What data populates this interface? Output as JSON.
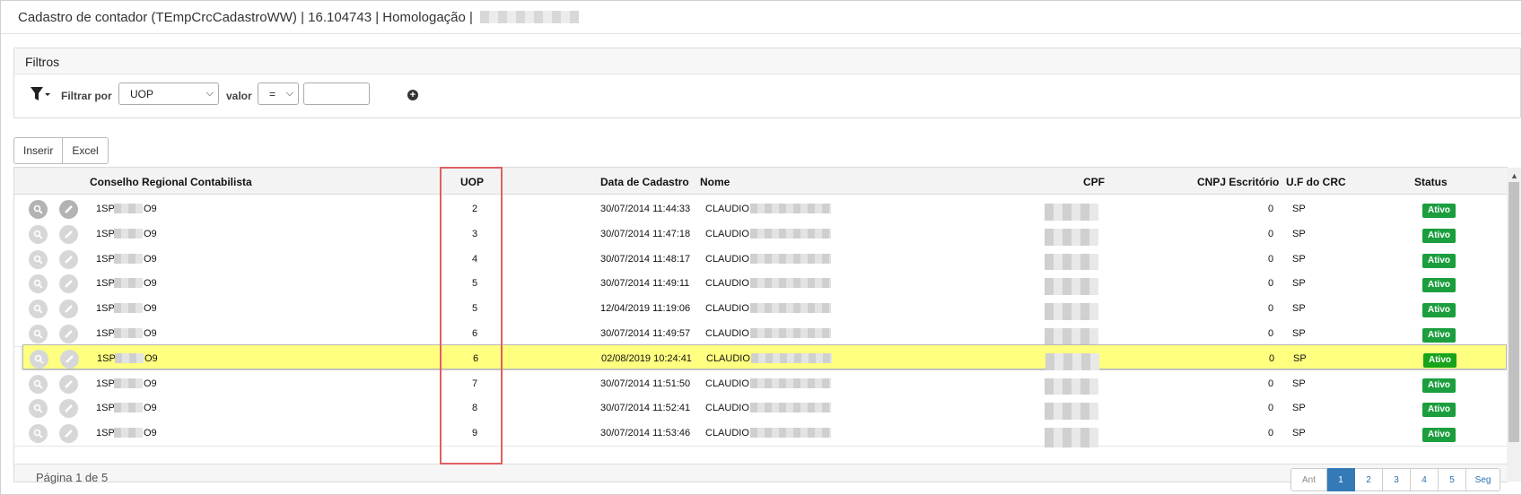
{
  "title": {
    "text": "Cadastro de contador (TEmpCrcCadastroWW) | 16.104743 | Homologação |"
  },
  "filters": {
    "heading": "Filtros",
    "filter_by_label": "Filtrar por",
    "field_select_value": "UOP",
    "value_label": "valor",
    "operator_value": "=",
    "value_input": ""
  },
  "actions": {
    "insert_label": "Inserir",
    "excel_label": "Excel"
  },
  "table": {
    "columns": [
      "Conselho Regional Contabilista",
      "UOP",
      "Data de Cadastro",
      "Nome",
      "CPF",
      "CNPJ Escritório",
      "U.F do CRC",
      "Status"
    ],
    "rows": [
      {
        "crc_prefix": "1SP",
        "crc_suffix": "O9",
        "uop": "2",
        "data": "30/07/2014 11:44:33",
        "nome": "CLAUDIO",
        "cnpj": "0",
        "uf": "SP",
        "status": "Ativo"
      },
      {
        "crc_prefix": "1SP",
        "crc_suffix": "O9",
        "uop": "3",
        "data": "30/07/2014 11:47:18",
        "nome": "CLAUDIO",
        "cnpj": "0",
        "uf": "SP",
        "status": "Ativo"
      },
      {
        "crc_prefix": "1SP",
        "crc_suffix": "O9",
        "uop": "4",
        "data": "30/07/2014 11:48:17",
        "nome": "CLAUDIO",
        "cnpj": "0",
        "uf": "SP",
        "status": "Ativo"
      },
      {
        "crc_prefix": "1SP",
        "crc_suffix": "O9",
        "uop": "5",
        "data": "30/07/2014 11:49:11",
        "nome": "CLAUDIO",
        "cnpj": "0",
        "uf": "SP",
        "status": "Ativo"
      },
      {
        "crc_prefix": "1SP",
        "crc_suffix": "O9",
        "uop": "5",
        "data": "12/04/2019 11:19:06",
        "nome": "CLAUDIO",
        "cnpj": "0",
        "uf": "SP",
        "status": "Ativo"
      },
      {
        "crc_prefix": "1SP",
        "crc_suffix": "O9",
        "uop": "6",
        "data": "30/07/2014 11:49:57",
        "nome": "CLAUDIO",
        "cnpj": "0",
        "uf": "SP",
        "status": "Ativo"
      },
      {
        "crc_prefix": "1SP",
        "crc_suffix": "O9",
        "uop": "6",
        "data": "02/08/2019 10:24:41",
        "nome": "CLAUDIO",
        "cnpj": "0",
        "uf": "SP",
        "status": "Ativo"
      },
      {
        "crc_prefix": "1SP",
        "crc_suffix": "O9",
        "uop": "7",
        "data": "30/07/2014 11:51:50",
        "nome": "CLAUDIO",
        "cnpj": "0",
        "uf": "SP",
        "status": "Ativo"
      },
      {
        "crc_prefix": "1SP",
        "crc_suffix": "O9",
        "uop": "8",
        "data": "30/07/2014 11:52:41",
        "nome": "CLAUDIO",
        "cnpj": "0",
        "uf": "SP",
        "status": "Ativo"
      },
      {
        "crc_prefix": "1SP",
        "crc_suffix": "O9",
        "uop": "9",
        "data": "30/07/2014 11:53:46",
        "nome": "CLAUDIO",
        "cnpj": "0",
        "uf": "SP",
        "status": "Ativo"
      }
    ],
    "highlighted_row": 6
  },
  "pagination": {
    "info": "Página 1 de 5",
    "prev_label": "Ant",
    "pages": [
      "1",
      "2",
      "3",
      "4",
      "5"
    ],
    "current_page": "1",
    "next_label": "Seg"
  },
  "icons": {
    "filter": "funnel-icon",
    "add_filter": "plus-circle-icon",
    "view": "magnifier-icon",
    "edit": "pencil-icon"
  },
  "colors": {
    "highlight_row": "#ffff80",
    "status_badge": "#1b9e3e",
    "uop_outline": "#e06060",
    "pager_active": "#337ab7"
  }
}
